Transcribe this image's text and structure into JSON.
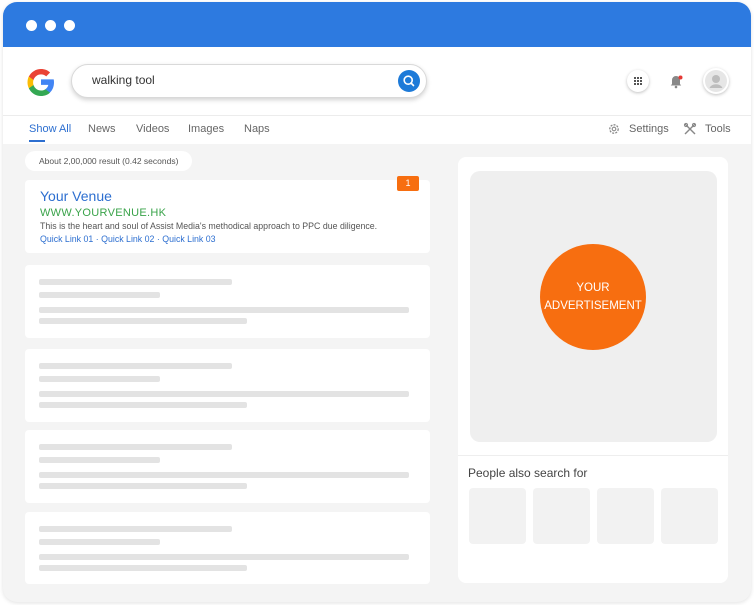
{
  "search": {
    "query": "walking tool"
  },
  "nav": {
    "tabs": [
      "Show All",
      "News",
      "Videos",
      "Images",
      "Naps"
    ],
    "settings_label": "Settings",
    "tools_label": "Tools"
  },
  "results": {
    "count_text": "About 2,00,000 result  (0.42 seconds)",
    "ad": {
      "title": "Your Venue",
      "url": "WWW.YOURVENUE.HK",
      "description": "This is the heart and soul of Assist Media's methodical approach to PPC due diligence.",
      "quick_links": [
        "Quick Link 01",
        "Quick Link 02",
        "Quick Link 03"
      ],
      "rank_badge": "1"
    }
  },
  "sidebar": {
    "ad_line1": "YOUR",
    "ad_line2": "ADVERTISEMENT",
    "people_also_search": "People also search for"
  },
  "colors": {
    "titlebar": "#2d7ae0",
    "accent_orange": "#f76e10",
    "link_blue": "#2d6fd0",
    "url_green": "#3aa34a"
  }
}
